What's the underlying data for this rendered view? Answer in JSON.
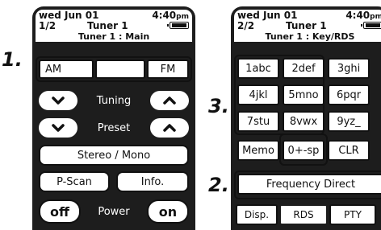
{
  "callouts": {
    "one": "1.",
    "two": "2.",
    "three": "3."
  },
  "left": {
    "status": {
      "date": "wed Jun 01",
      "time": "4:40",
      "time_suffix": "pm",
      "page": "1/2",
      "tuner": "Tuner 1",
      "subtitle": "Tuner 1 : Main"
    },
    "band": {
      "am": "AM",
      "fm": "FM"
    },
    "tuning_label": "Tuning",
    "preset_label": "Preset",
    "stereo_mono": "Stereo / Mono",
    "pscan": "P-Scan",
    "info": "Info.",
    "power_off": "off",
    "power_label": "Power",
    "power_on": "on"
  },
  "right": {
    "status": {
      "date": "wed Jun 01",
      "time": "4:40",
      "time_suffix": "pm",
      "page": "2/2",
      "tuner": "Tuner 1",
      "subtitle": "Tuner 1 : Key/RDS"
    },
    "keys": [
      "1abc",
      "2def",
      "3ghi",
      "4jkl",
      "5mno",
      "6pqr",
      "7stu",
      "8vwx",
      "9yz_",
      "Memo",
      "0+-sp",
      "CLR"
    ],
    "frequency_direct": "Frequency Direct",
    "disp": "Disp.",
    "rds": "RDS",
    "pty": "PTY"
  },
  "icons": {
    "up": "chevron-up-icon",
    "down": "chevron-down-icon",
    "battery": "battery-icon"
  }
}
